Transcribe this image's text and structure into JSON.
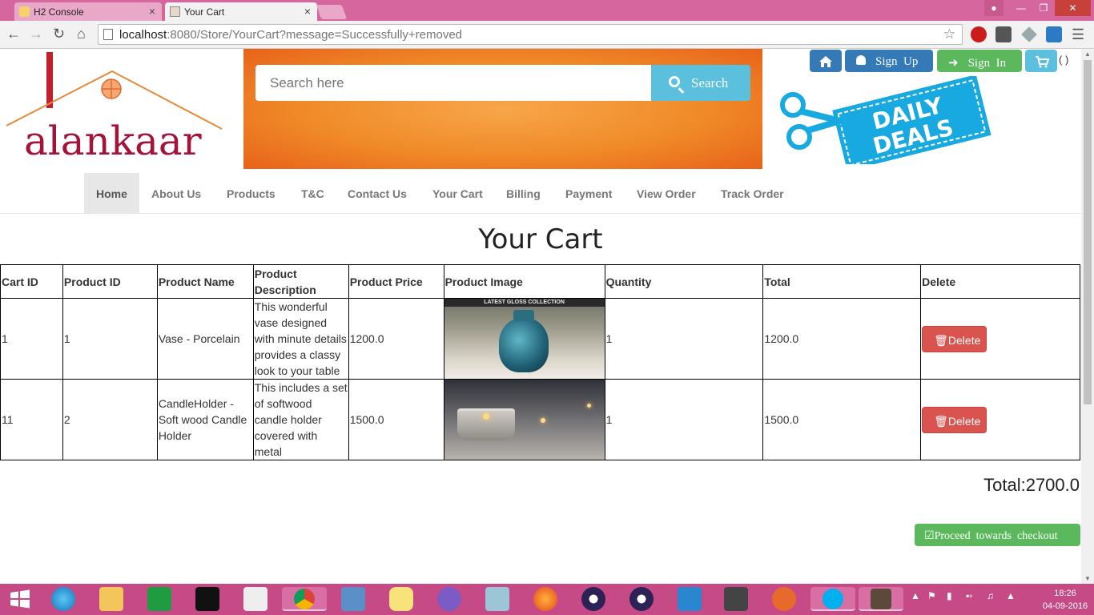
{
  "browser": {
    "tabs": [
      {
        "label": "H2 Console",
        "close": "×"
      },
      {
        "label": "Your Cart",
        "close": "×"
      }
    ],
    "url_host": "localhost",
    "url_rest": ":8080/Store/YourCart?message=Successfully+removed"
  },
  "header": {
    "logo_text": "alankaar",
    "search_placeholder": "Search here",
    "search_label": "Search",
    "signup_label": "Sign  Up",
    "signin_label": "Sign  In",
    "cart_count": "( )",
    "deals_line1": "DAILY",
    "deals_line2": "DEALS"
  },
  "nav": {
    "items": [
      {
        "label": "Home"
      },
      {
        "label": "About Us"
      },
      {
        "label": "Products"
      },
      {
        "label": "T&C"
      },
      {
        "label": "Contact Us"
      },
      {
        "label": "Your Cart"
      },
      {
        "label": "Billing"
      },
      {
        "label": "Payment"
      },
      {
        "label": "View Order"
      },
      {
        "label": "Track Order"
      }
    ]
  },
  "cart": {
    "title": "Your Cart",
    "columns": [
      "Cart ID",
      "Product ID",
      "Product Name",
      "Product Description",
      "Product Price",
      "Product Image",
      "Quantity",
      "Total",
      "Delete"
    ],
    "rows": [
      {
        "cart_id": "1",
        "product_id": "1",
        "name": "Vase - Porcelain",
        "description": "This wonderful vase designed with minute details provides a classy look to your table",
        "price": "1200.0",
        "image_caption": "LATEST GLOSS COLLECTION",
        "quantity": "1",
        "total": "1200.0",
        "delete_label": "Delete"
      },
      {
        "cart_id": "11",
        "product_id": "2",
        "name": "CandleHolder - Soft wood Candle Holder",
        "description": "This includes a set of softwood candle holder covered with metal",
        "price": "1500.0",
        "image_caption": "",
        "quantity": "1",
        "total": "1500.0",
        "delete_label": "Delete"
      }
    ],
    "grand_total": "Total:2700.0",
    "checkout_label": "Proceed  towards  checkout"
  },
  "taskbar": {
    "time": "18:26",
    "date": "04-09-2016"
  }
}
